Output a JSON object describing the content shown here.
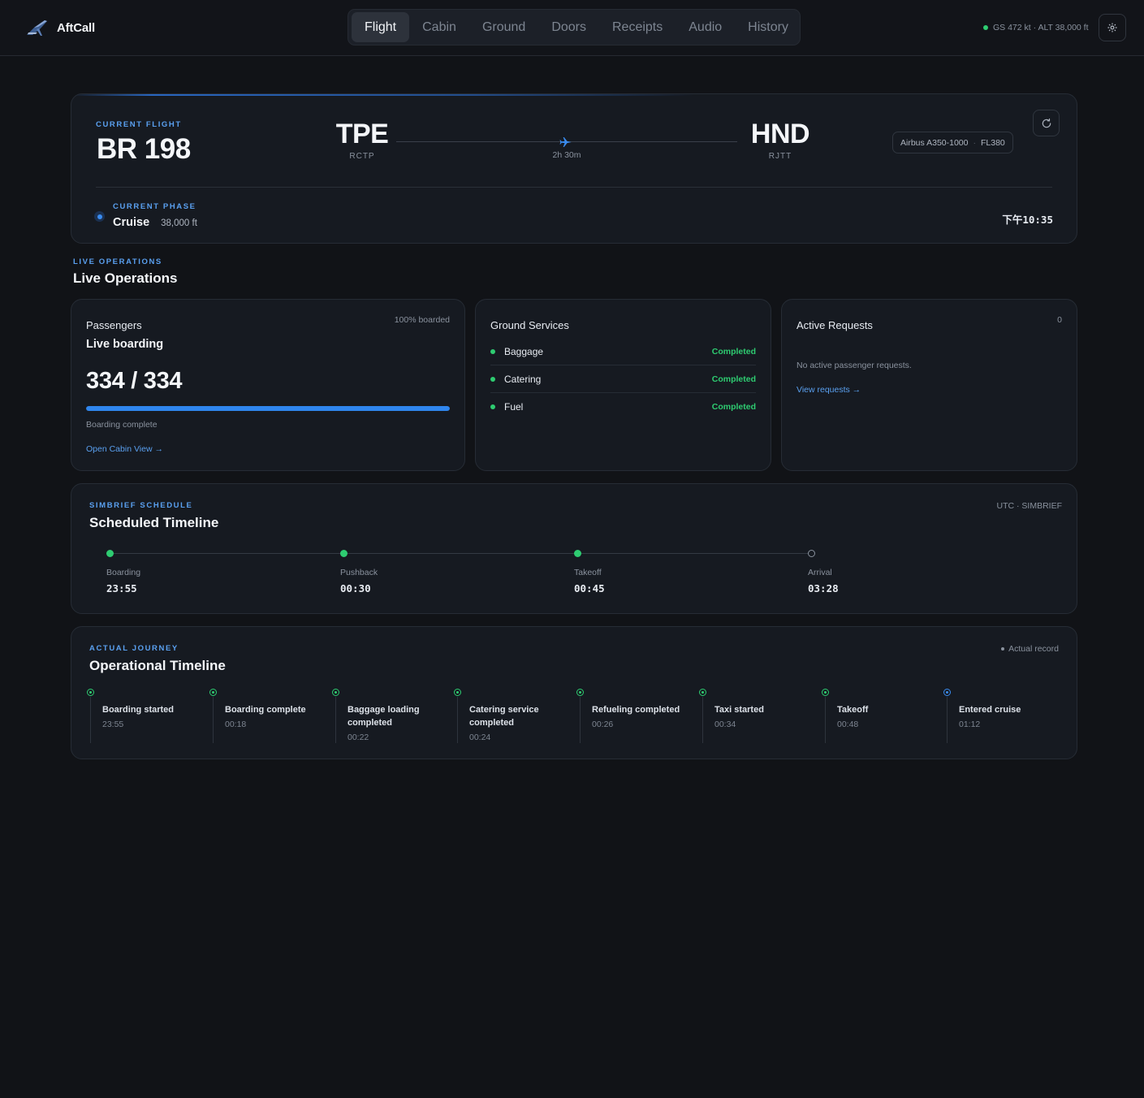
{
  "app": {
    "name": "AftCall"
  },
  "nav": {
    "tabs": [
      {
        "label": "Flight",
        "active": true
      },
      {
        "label": "Cabin",
        "active": false
      },
      {
        "label": "Ground",
        "active": false
      },
      {
        "label": "Doors",
        "active": false
      },
      {
        "label": "Receipts",
        "active": false
      },
      {
        "label": "Audio",
        "active": false
      },
      {
        "label": "History",
        "active": false
      }
    ]
  },
  "status": {
    "text": "GS 472 kt · ALT 38,000 ft",
    "color": "#2ecc71"
  },
  "flight": {
    "kicker": "CURRENT FLIGHT",
    "number": "BR 198",
    "origin": {
      "code": "TPE",
      "icao": "RCTP"
    },
    "destination": {
      "code": "HND",
      "icao": "RJTT"
    },
    "duration": "2h 30m",
    "aircraft": "Airbus A350-1000",
    "flight_level": "FL380",
    "phase_kicker": "CURRENT PHASE",
    "phase": "Cruise",
    "altitude": "38,000 ft",
    "local_time": "下午10:35"
  },
  "live_ops": {
    "kicker": "LIVE OPERATIONS",
    "title": "Live Operations",
    "passengers": {
      "heading": "Passengers",
      "subheading": "Live boarding",
      "boarded_note": "100% boarded",
      "count": "334 / 334",
      "progress_fraction": 1.0,
      "status": "Boarding complete",
      "link": "Open Cabin View →"
    },
    "ground": {
      "heading": "Ground Services",
      "services": [
        {
          "name": "Baggage",
          "state": "Completed"
        },
        {
          "name": "Catering",
          "state": "Completed"
        },
        {
          "name": "Fuel",
          "state": "Completed"
        }
      ]
    },
    "requests": {
      "heading": "Active Requests",
      "count": "0",
      "empty_text": "No active passenger requests.",
      "link": "View requests →"
    }
  },
  "schedule": {
    "kicker": "SIMBRIEF SCHEDULE",
    "title": "Scheduled Timeline",
    "note": "UTC · SIMBRIEF",
    "points": [
      {
        "label": "Boarding",
        "time": "23:55",
        "done": true
      },
      {
        "label": "Pushback",
        "time": "00:30",
        "done": true
      },
      {
        "label": "Takeoff",
        "time": "00:45",
        "done": true
      },
      {
        "label": "Arrival",
        "time": "03:28",
        "done": false
      }
    ]
  },
  "journey": {
    "kicker": "ACTUAL JOURNEY",
    "title": "Operational Timeline",
    "note": "Actual record",
    "events": [
      {
        "title": "Boarding started",
        "time": "23:55",
        "current": false
      },
      {
        "title": "Boarding complete",
        "time": "00:18",
        "current": false
      },
      {
        "title": "Baggage loading completed",
        "time": "00:22",
        "current": false
      },
      {
        "title": "Catering service completed",
        "time": "00:24",
        "current": false
      },
      {
        "title": "Refueling completed",
        "time": "00:26",
        "current": false
      },
      {
        "title": "Taxi started",
        "time": "00:34",
        "current": false
      },
      {
        "title": "Takeoff",
        "time": "00:48",
        "current": false
      },
      {
        "title": "Entered cruise",
        "time": "01:12",
        "current": true
      }
    ]
  }
}
